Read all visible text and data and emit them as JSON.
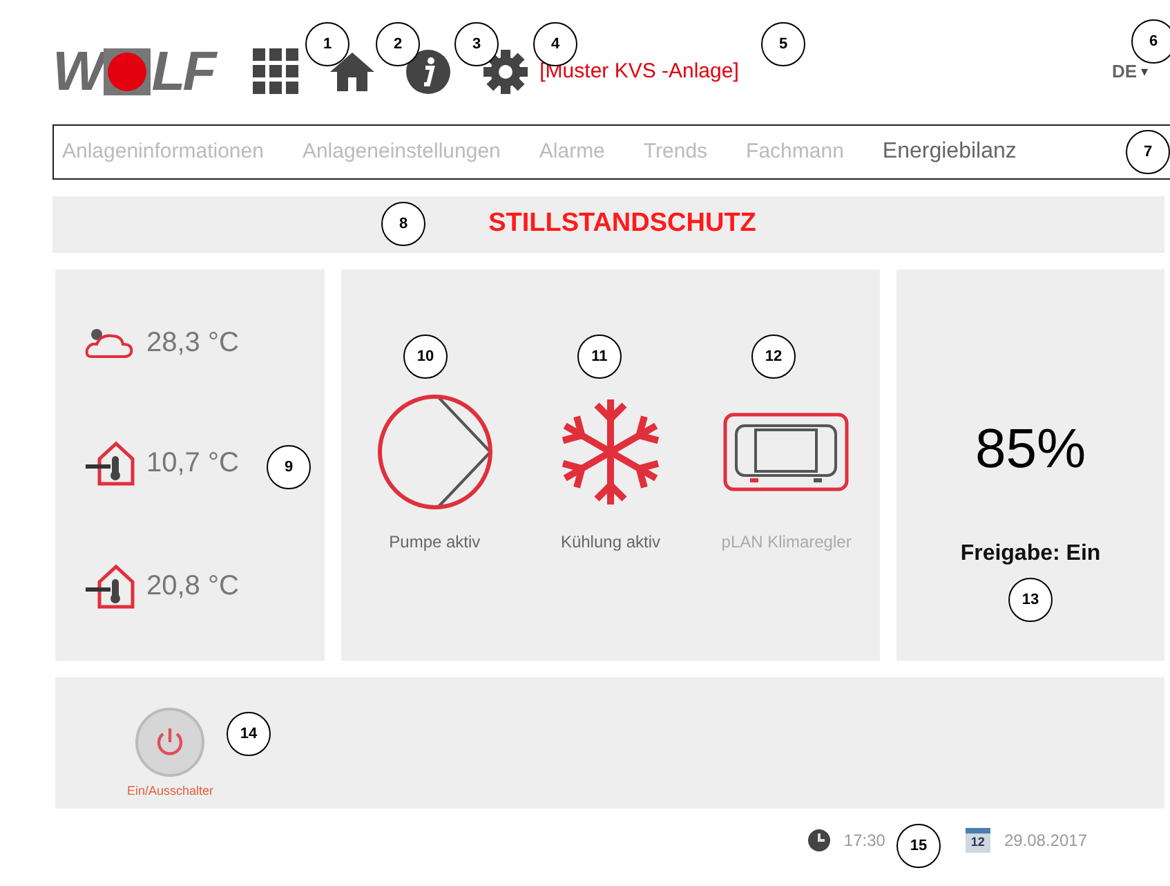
{
  "logo": {
    "before": "W",
    "after": "LF"
  },
  "header": {
    "plant_name": "[Muster KVS -Anlage]",
    "language": "DE",
    "caret": "▾"
  },
  "nav": [
    {
      "label": "Anlageninformationen",
      "selected": false
    },
    {
      "label": "Anlageneinstellungen",
      "selected": false
    },
    {
      "label": "Alarme",
      "selected": false
    },
    {
      "label": "Trends",
      "selected": false
    },
    {
      "label": "Fachmann",
      "selected": false
    },
    {
      "label": "Energiebilanz",
      "selected": true
    }
  ],
  "banner": "STILLSTANDSCHUTZ",
  "temperatures": [
    {
      "kind": "outdoor",
      "value": "28,3 °C"
    },
    {
      "kind": "indoor",
      "value": "10,7 °C"
    },
    {
      "kind": "indoor",
      "value": "20,8 °C"
    }
  ],
  "components": [
    {
      "kind": "pump",
      "label": "Pumpe aktiv"
    },
    {
      "kind": "cooling",
      "label": "Kühlung aktiv"
    },
    {
      "kind": "controller",
      "label": "pLAN Klimaregler"
    }
  ],
  "output": {
    "percent": "85%",
    "release": "Freigabe: Ein"
  },
  "power_switch": {
    "label": "Ein/Ausschalter"
  },
  "status_bar": {
    "time": "17:30",
    "calendar_day": "12",
    "date": "29.08.2017"
  },
  "callouts": [
    "1",
    "2",
    "3",
    "4",
    "5",
    "6",
    "7",
    "8",
    "9",
    "10",
    "11",
    "12",
    "13",
    "14",
    "15"
  ]
}
